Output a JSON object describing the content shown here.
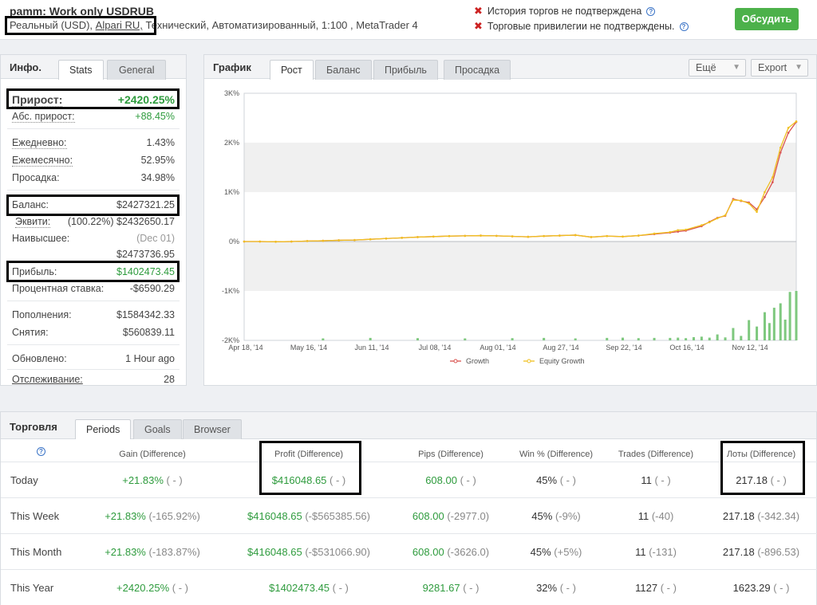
{
  "header": {
    "account_name": "pamm: Work only USDRUB",
    "account_type": "Реальный (USD),",
    "broker": "Alpari RU,",
    "details": "Технический, Автоматизированный, 1:100 , MetaTrader 4",
    "warnings": [
      "История торгов не подтверждена",
      "Торговые привилегии не подтверждены."
    ],
    "discuss_label": "Обсудить"
  },
  "info_panel": {
    "title": "Инфо.",
    "tabs": [
      "Stats",
      "General"
    ],
    "rows": [
      {
        "label": "Прирост:",
        "value": "+2420.25%"
      },
      {
        "label": "Абс. прирост:",
        "value": "+88.45%"
      },
      {
        "label": "Ежедневно:",
        "value": "1.43%"
      },
      {
        "label": "Ежемесячно:",
        "value": "52.95%"
      },
      {
        "label": "Просадка:",
        "value": "34.98%"
      },
      {
        "label": "Баланс:",
        "value": "$2427321.25"
      },
      {
        "label": "Эквити:",
        "value": "(100.22%) $2432650.17"
      },
      {
        "label": "Наивысшее:",
        "value": "(Dec 01)"
      },
      {
        "label": "",
        "value": "$2473736.95"
      },
      {
        "label": "Прибыль:",
        "value": "$1402473.45"
      },
      {
        "label": "Процентная ставка:",
        "value": "-$6590.29"
      },
      {
        "label": "Пополнения:",
        "value": "$1584342.33"
      },
      {
        "label": "Снятия:",
        "value": "$560839.11"
      },
      {
        "label": "Обновлено:",
        "value": "1 Hour ago"
      },
      {
        "label": "Отслеживание:",
        "value": "28"
      }
    ]
  },
  "chart_panel": {
    "title": "График",
    "tabs": [
      "Рост",
      "Баланс",
      "Прибыль",
      "Просадка"
    ],
    "more_label": "Ещё",
    "export_label": "Export"
  },
  "chart_data": {
    "type": "line",
    "y_ticks": [
      "3K%",
      "2K%",
      "1K%",
      "0%",
      "-1K%",
      "-2K%"
    ],
    "ylim": [
      -2000,
      3000
    ],
    "x_ticks": [
      "Apr 18, '14",
      "May 16, '14",
      "Jun 11, '14",
      "Jul 08, '14",
      "Aug 01, '14",
      "Aug 27, '14",
      "Sep 22, '14",
      "Oct 16, '14",
      "Nov 12, '14"
    ],
    "x_range": [
      0,
      35
    ],
    "series": [
      {
        "name": "Growth",
        "color": "#d9534f",
        "x": [
          0,
          1,
          2,
          3,
          4,
          5,
          6,
          7,
          8,
          9,
          10,
          11,
          12,
          13,
          14,
          15,
          16,
          17,
          18,
          19,
          20,
          21,
          22,
          23,
          24,
          25,
          26,
          27,
          27.5,
          28,
          29,
          29.5,
          30,
          30.5,
          31,
          31.5,
          32,
          32.5,
          33,
          33.5,
          34,
          34.5,
          35
        ],
        "y": [
          0,
          0,
          -5,
          0,
          10,
          15,
          25,
          30,
          45,
          60,
          75,
          90,
          100,
          110,
          115,
          120,
          115,
          105,
          95,
          110,
          120,
          130,
          90,
          110,
          100,
          120,
          150,
          180,
          200,
          220,
          310,
          400,
          480,
          520,
          860,
          820,
          790,
          650,
          900,
          1200,
          1800,
          2200,
          2420
        ]
      },
      {
        "name": "Equity Growth",
        "color": "#f0c020",
        "x": [
          0,
          1,
          2,
          3,
          4,
          5,
          6,
          7,
          8,
          9,
          10,
          11,
          12,
          13,
          14,
          15,
          16,
          17,
          18,
          19,
          20,
          21,
          22,
          23,
          24,
          25,
          26,
          27,
          27.5,
          28,
          29,
          29.5,
          30,
          30.5,
          31,
          31.5,
          32,
          32.5,
          33,
          33.5,
          34,
          34.5,
          35
        ],
        "y": [
          0,
          0,
          -5,
          0,
          10,
          15,
          25,
          30,
          45,
          60,
          75,
          90,
          100,
          110,
          115,
          120,
          115,
          105,
          95,
          110,
          120,
          130,
          90,
          110,
          100,
          120,
          160,
          190,
          230,
          240,
          330,
          390,
          470,
          530,
          840,
          830,
          770,
          600,
          1000,
          1300,
          1900,
          2300,
          2430
        ]
      }
    ],
    "bars": {
      "color": "#7ec87e",
      "x": [
        5,
        8,
        11,
        14,
        17,
        19,
        21,
        23,
        24,
        25,
        26,
        27,
        27.5,
        28,
        28.5,
        29,
        29.5,
        30,
        30.5,
        31,
        31.5,
        32,
        32.5,
        33,
        33.3,
        33.6,
        34,
        34.3,
        34.6,
        35
      ],
      "y": [
        -1960,
        -1950,
        -1955,
        -1960,
        -1955,
        -1950,
        -1960,
        -1950,
        -1945,
        -1955,
        -1950,
        -1950,
        -1945,
        -1955,
        -1935,
        -1925,
        -1945,
        -1880,
        -1940,
        -1750,
        -1910,
        -1590,
        -1720,
        -1430,
        -1650,
        -1340,
        -1250,
        -1580,
        -1020,
        -1000
      ]
    }
  },
  "trading_panel": {
    "title": "Торговля",
    "tabs": [
      "Periods",
      "Goals",
      "Browser"
    ],
    "columns": [
      "Gain (Difference)",
      "Profit (Difference)",
      "Pips (Difference)",
      "Win % (Difference)",
      "Trades (Difference)",
      "Лоты (Difference)"
    ],
    "rows": [
      {
        "label": "Today",
        "gain": [
          "+21.83%",
          "( - )"
        ],
        "profit": [
          "$416048.65",
          "( - )"
        ],
        "pips": [
          "608.00",
          "( - )"
        ],
        "win": [
          "45%",
          "( - )"
        ],
        "trades": [
          "11",
          "( - )"
        ],
        "lots": [
          "217.18",
          "( - )"
        ]
      },
      {
        "label": "This Week",
        "gain": [
          "+21.83%",
          "(-165.92%)"
        ],
        "profit": [
          "$416048.65",
          "(-$565385.56)"
        ],
        "pips": [
          "608.00",
          "(-2977.0)"
        ],
        "win": [
          "45%",
          "(-9%)"
        ],
        "trades": [
          "11",
          "(-40)"
        ],
        "lots": [
          "217.18",
          "(-342.34)"
        ]
      },
      {
        "label": "This Month",
        "gain": [
          "+21.83%",
          "(-183.87%)"
        ],
        "profit": [
          "$416048.65",
          "(-$531066.90)"
        ],
        "pips": [
          "608.00",
          "(-3626.0)"
        ],
        "win": [
          "45%",
          "(+5%)"
        ],
        "trades": [
          "11",
          "(-131)"
        ],
        "lots": [
          "217.18",
          "(-896.53)"
        ]
      },
      {
        "label": "This Year",
        "gain": [
          "+2420.25%",
          "( - )"
        ],
        "profit": [
          "$1402473.45",
          "( - )"
        ],
        "pips": [
          "9281.67",
          "( - )"
        ],
        "win": [
          "32%",
          "( - )"
        ],
        "trades": [
          "1127",
          "( - )"
        ],
        "lots": [
          "1623.29",
          "( - )"
        ]
      }
    ]
  }
}
